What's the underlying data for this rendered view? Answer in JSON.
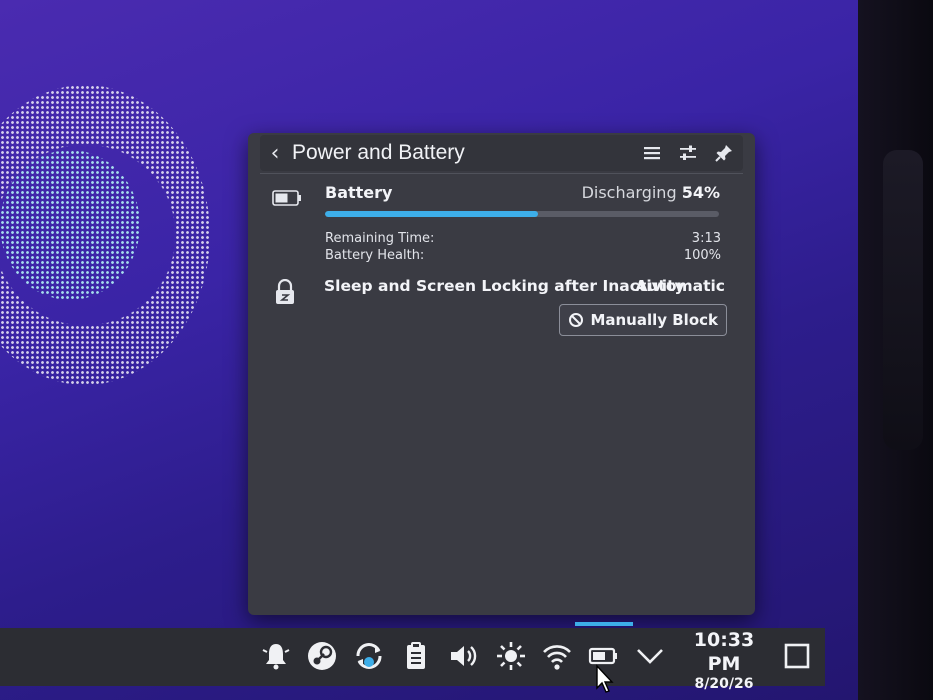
{
  "popup": {
    "title": "Power and Battery",
    "header_icons": [
      "hamburger-menu-icon",
      "configure-icon",
      "pin-icon"
    ],
    "battery": {
      "label": "Battery",
      "state": "Discharging",
      "percent_text": "54%",
      "charge_fraction": 0.54,
      "remaining_label": "Remaining Time:",
      "remaining_value": "3:13",
      "health_label": "Battery Health:",
      "health_value": "100%"
    },
    "sleep": {
      "label": "Sleep and Screen Locking after Inactivity",
      "mode": "Automatic",
      "button_label": "Manually Block"
    }
  },
  "taskbar": {
    "tray_icons": [
      "notifications-icon",
      "steam-icon",
      "update-icon",
      "clipboard-icon",
      "volume-icon",
      "brightness-icon",
      "wifi-icon",
      "battery-icon",
      "expand-tray-icon"
    ],
    "time": "10:33 PM",
    "date": "8/20/26",
    "accent_color": "#3daee9"
  }
}
